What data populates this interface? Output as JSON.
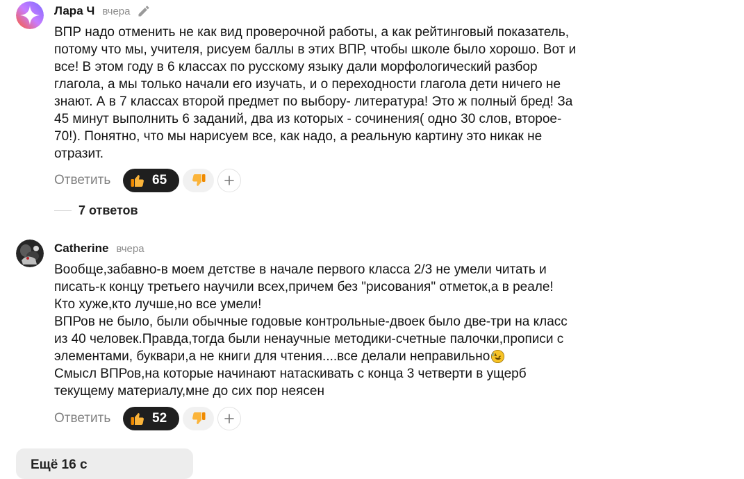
{
  "comments": [
    {
      "author": "Лара Ч",
      "time": "вчера",
      "edited_icon": "pencil-icon",
      "lines": [
        "ВПР надо отменить не как вид проверочной работы, а как рейтинговый показатель,",
        "потому что мы, учителя, рисуем баллы в этих ВПР, чтобы школе было хорошо. Вот и",
        "все! В этом году в 6 классах по русскому языку дали морфологический разбор",
        "глагола, а мы только начали его изучать, и о переходности глагола дети ничего не",
        "знают. А в 7 классах второй предмет по выбору- литература! Это ж полный бред! За",
        "45 минут выполнить 6 заданий, два из которых - сочинения( одно 30 слов, второе-",
        "70!). Понятно, что мы нарисуем все, как надо, а реальную картину это никак не",
        "отразит."
      ],
      "reply_label": "Ответить",
      "likes": "65",
      "replies_label": "7 ответов"
    },
    {
      "author": "Catherine",
      "time": "вчера",
      "lines": [
        "Вообще,забавно-в моем детстве в начале первого класса 2/3 не умели читать и",
        "писать-к концу третьего научили всех,причем без \"рисования\" отметок,а в реале!",
        "Кто хуже,кто лучше,но все умели!",
        "ВПРов не было, были обычные годовые контрольные-двоек было две-три на класс",
        "из 40 человек.Правда,тогда были ненаучные методики-счетные палочки,прописи с",
        "элементами, буквари,а не книги для чтения....все делали неправильно",
        "Смысл ВПРов,на которые начинают натаскивать с конца 3 четверти в ущерб",
        "текущему материалу,мне до сих пор неясен"
      ],
      "inline_emoji": "rolling-on-floor-laughing-emoji",
      "reply_label": "Ответить",
      "likes": "52"
    }
  ],
  "more_button": {
    "label": "Ещё 16 с"
  },
  "icons": {
    "like": "thumbs-up-icon",
    "dislike": "thumbs-down-icon",
    "add_reaction": "plus-icon"
  },
  "colors": {
    "like_pill": "#1f1f1f",
    "dislike_pill": "#f1f1f1",
    "muted_text": "#7f7f7f",
    "thumb": "#f5a623"
  }
}
